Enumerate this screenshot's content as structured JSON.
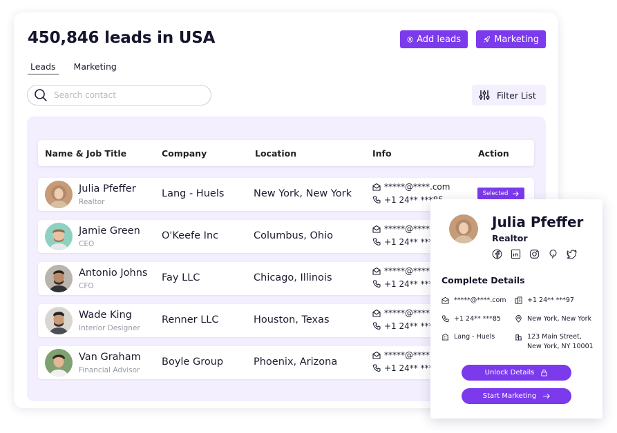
{
  "header": {
    "title": "450,846 leads in USA",
    "add_leads_label": "Add leads",
    "marketing_label": "Marketing"
  },
  "tabs": [
    {
      "label": "Leads",
      "active": true
    },
    {
      "label": "Marketing",
      "active": false
    }
  ],
  "search": {
    "placeholder": "Search contact",
    "value": ""
  },
  "filter": {
    "label": "Filter List"
  },
  "table": {
    "columns": [
      "Name & Job Title",
      "Company",
      "Location",
      "Info",
      "Action"
    ],
    "rows": [
      {
        "name": "Julia Pfeffer",
        "job": "Realtor",
        "company": "Lang - Huels",
        "location": "New York, New York",
        "email": "*****@****.com",
        "phone": "+1 24** ***85",
        "action": "Selected"
      },
      {
        "name": "Jamie Green",
        "job": "CEO",
        "company": "O'Keefe Inc",
        "location": "Columbus, Ohio",
        "email": "*****@****.com",
        "phone": "+1 24** ***97"
      },
      {
        "name": "Antonio Johns",
        "job": "CFO",
        "company": "Fay LLC",
        "location": "Chicago, Illinois",
        "email": "*****@****.com",
        "phone": "+1 24** ***24"
      },
      {
        "name": "Wade King",
        "job": "Interior Designer",
        "company": "Renner LLC",
        "location": "Houston, Texas",
        "email": "*****@****.com",
        "phone": "+1 24** ***77"
      },
      {
        "name": "Van Graham",
        "job": "Financial Advisor",
        "company": "Boyle Group",
        "location": "Phoenix, Arizona",
        "email": "*****@****.com",
        "phone": "+1 24** ***60"
      }
    ]
  },
  "profile": {
    "name": "Julia Pfeffer",
    "role": "Realtor",
    "socials": [
      "facebook-icon",
      "linkedin-icon",
      "instagram-icon",
      "pinterest-icon",
      "twitter-icon"
    ],
    "section_title": "Complete Details",
    "email": "*****@****.com",
    "phone_1": "+1 24** ***97",
    "phone_2": "+1 24** ***85",
    "location": "New York, New York",
    "company": "Lang - Huels",
    "address_line1": "123 Main Street,",
    "address_line2": "New York, NY 10001",
    "unlock_label": "Unlock Details",
    "start_label": "Start Marketing"
  },
  "colors": {
    "accent": "#7c3aed",
    "panel_bg": "#f4effe",
    "filter_bg": "#f3effd"
  }
}
